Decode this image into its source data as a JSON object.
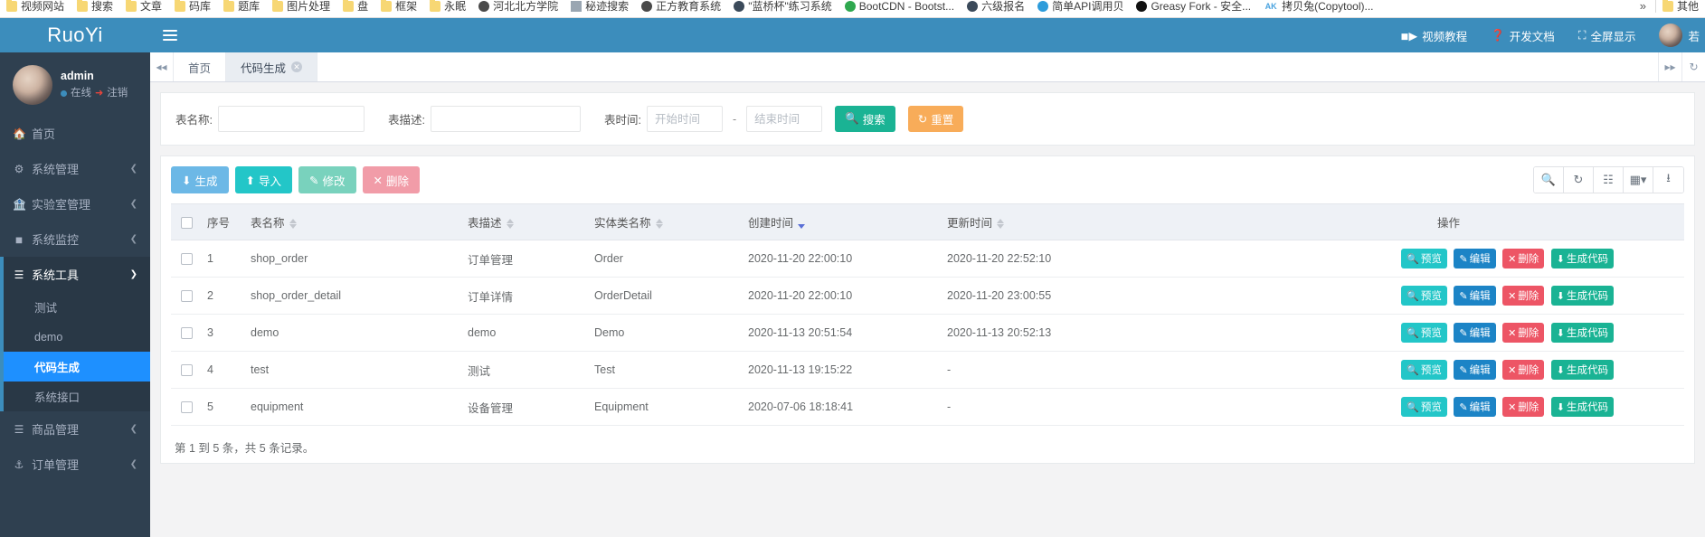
{
  "browser": {
    "bookmarks": [
      {
        "label": "视频网站",
        "icon": "folder-icon"
      },
      {
        "label": "搜索",
        "icon": "folder-icon"
      },
      {
        "label": "文章",
        "icon": "folder-icon"
      },
      {
        "label": "码库",
        "icon": "folder-icon"
      },
      {
        "label": "题库",
        "icon": "folder-icon"
      },
      {
        "label": "图片处理",
        "icon": "folder-icon"
      },
      {
        "label": "盘",
        "icon": "folder-icon"
      },
      {
        "label": "框架",
        "icon": "folder-icon"
      },
      {
        "label": "永眠",
        "icon": "folder-icon"
      },
      {
        "label": "河北北方学院",
        "icon": "site-icon"
      },
      {
        "label": "秘迹搜索",
        "icon": "shield-icon"
      },
      {
        "label": "正方教育系统",
        "icon": "site-icon"
      },
      {
        "label": "\"蓝桥杯\"练习系统",
        "icon": "site-icon"
      },
      {
        "label": "BootCDN - Bootst...",
        "icon": "bootcdn-icon"
      },
      {
        "label": "六级报名",
        "icon": "site-icon"
      },
      {
        "label": "简单API调用贝",
        "icon": "api-icon"
      },
      {
        "label": "Greasy Fork - 安全...",
        "icon": "greasyfork-icon"
      },
      {
        "label": "拷贝兔(Copytool)...",
        "icon": "ak-icon"
      }
    ],
    "overflow_label": "»",
    "other_bookmarks": "其他"
  },
  "sidebar": {
    "brand": "RuoYi",
    "user": {
      "name": "admin",
      "status": "在线",
      "logout": "注销"
    },
    "items": [
      {
        "label": "首页",
        "icon": "home-icon",
        "expandable": false
      },
      {
        "label": "系统管理",
        "icon": "gear-icon",
        "expandable": true
      },
      {
        "label": "实验室管理",
        "icon": "bank-icon",
        "expandable": true
      },
      {
        "label": "系统监控",
        "icon": "video-icon",
        "expandable": true
      },
      {
        "label": "系统工具",
        "icon": "list-icon",
        "expandable": true,
        "open": true
      },
      {
        "label": "商品管理",
        "icon": "list-icon",
        "expandable": true
      },
      {
        "label": "订单管理",
        "icon": "anchor-icon",
        "expandable": true
      }
    ],
    "submenu": [
      {
        "label": "测试",
        "active": false
      },
      {
        "label": "demo",
        "active": false
      },
      {
        "label": "代码生成",
        "active": true
      },
      {
        "label": "系统接口",
        "active": false
      }
    ]
  },
  "navbar": {
    "hamburger": "menu-icon",
    "links": [
      {
        "label": "视频教程",
        "icon": "video-icon"
      },
      {
        "label": "开发文档",
        "icon": "question-circle-icon"
      },
      {
        "label": "全屏显示",
        "icon": "fullscreen-icon"
      }
    ],
    "username": "若"
  },
  "tabs": {
    "prev_icon": "double-left-icon",
    "next_icon": "double-right-icon",
    "refresh_icon": "refresh-icon",
    "items": [
      {
        "label": "首页",
        "active": false,
        "closable": false
      },
      {
        "label": "代码生成",
        "active": true,
        "closable": true
      }
    ]
  },
  "search": {
    "table_name_label": "表名称:",
    "table_name_value": "",
    "table_desc_label": "表描述:",
    "table_desc_value": "",
    "table_time_label": "表时间:",
    "start_time_placeholder": "开始时间",
    "start_time_value": "",
    "end_time_placeholder": "结束时间",
    "end_time_value": "",
    "separator": "-",
    "search_button": "搜索",
    "reset_button": "重置"
  },
  "toolbar": {
    "generate": "生成",
    "import": "导入",
    "edit": "修改",
    "delete": "删除",
    "icons": [
      "search-icon",
      "refresh-icon",
      "list-view-icon",
      "columns-icon",
      "export-icon"
    ]
  },
  "table": {
    "headers": [
      {
        "label": "",
        "key": "check",
        "sortable": false
      },
      {
        "label": "序号",
        "key": "index",
        "sortable": false
      },
      {
        "label": "表名称",
        "key": "table_name",
        "sortable": true
      },
      {
        "label": "表描述",
        "key": "table_desc",
        "sortable": true
      },
      {
        "label": "实体类名称",
        "key": "entity",
        "sortable": true
      },
      {
        "label": "创建时间",
        "key": "create_time",
        "sortable": true,
        "sorted": "desc"
      },
      {
        "label": "更新时间",
        "key": "update_time",
        "sortable": true
      },
      {
        "label": "操作",
        "key": "actions",
        "sortable": false
      }
    ],
    "rows": [
      {
        "index": "1",
        "table_name": "shop_order",
        "table_desc": "订单管理",
        "entity": "Order",
        "create_time": "2020-11-20 22:00:10",
        "update_time": "2020-11-20 22:52:10"
      },
      {
        "index": "2",
        "table_name": "shop_order_detail",
        "table_desc": "订单详情",
        "entity": "OrderDetail",
        "create_time": "2020-11-20 22:00:10",
        "update_time": "2020-11-20 23:00:55"
      },
      {
        "index": "3",
        "table_name": "demo",
        "table_desc": "demo",
        "entity": "Demo",
        "create_time": "2020-11-13 20:51:54",
        "update_time": "2020-11-13 20:52:13"
      },
      {
        "index": "4",
        "table_name": "test",
        "table_desc": "测试",
        "entity": "Test",
        "create_time": "2020-11-13 19:15:22",
        "update_time": "-"
      },
      {
        "index": "5",
        "table_name": "equipment",
        "table_desc": "设备管理",
        "entity": "Equipment",
        "create_time": "2020-07-06 18:18:41",
        "update_time": "-"
      }
    ],
    "row_actions": [
      {
        "label": "预览",
        "icon": "search-icon",
        "color": "#23c6c8"
      },
      {
        "label": "编辑",
        "icon": "pencil-square-icon",
        "color": "#1c84c6"
      },
      {
        "label": "删除",
        "icon": "close-icon",
        "color": "#ed5565"
      },
      {
        "label": "生成代码",
        "icon": "download-icon",
        "color": "#1ab394"
      }
    ],
    "footer": "第 1 到 5 条，共 5 条记录。"
  },
  "colors": {
    "brand_blue": "#3c8dbc",
    "sidebar_dark": "#2f4050",
    "active_blue": "#1e90ff",
    "green": "#1ab394",
    "orange": "#f8ac59"
  }
}
